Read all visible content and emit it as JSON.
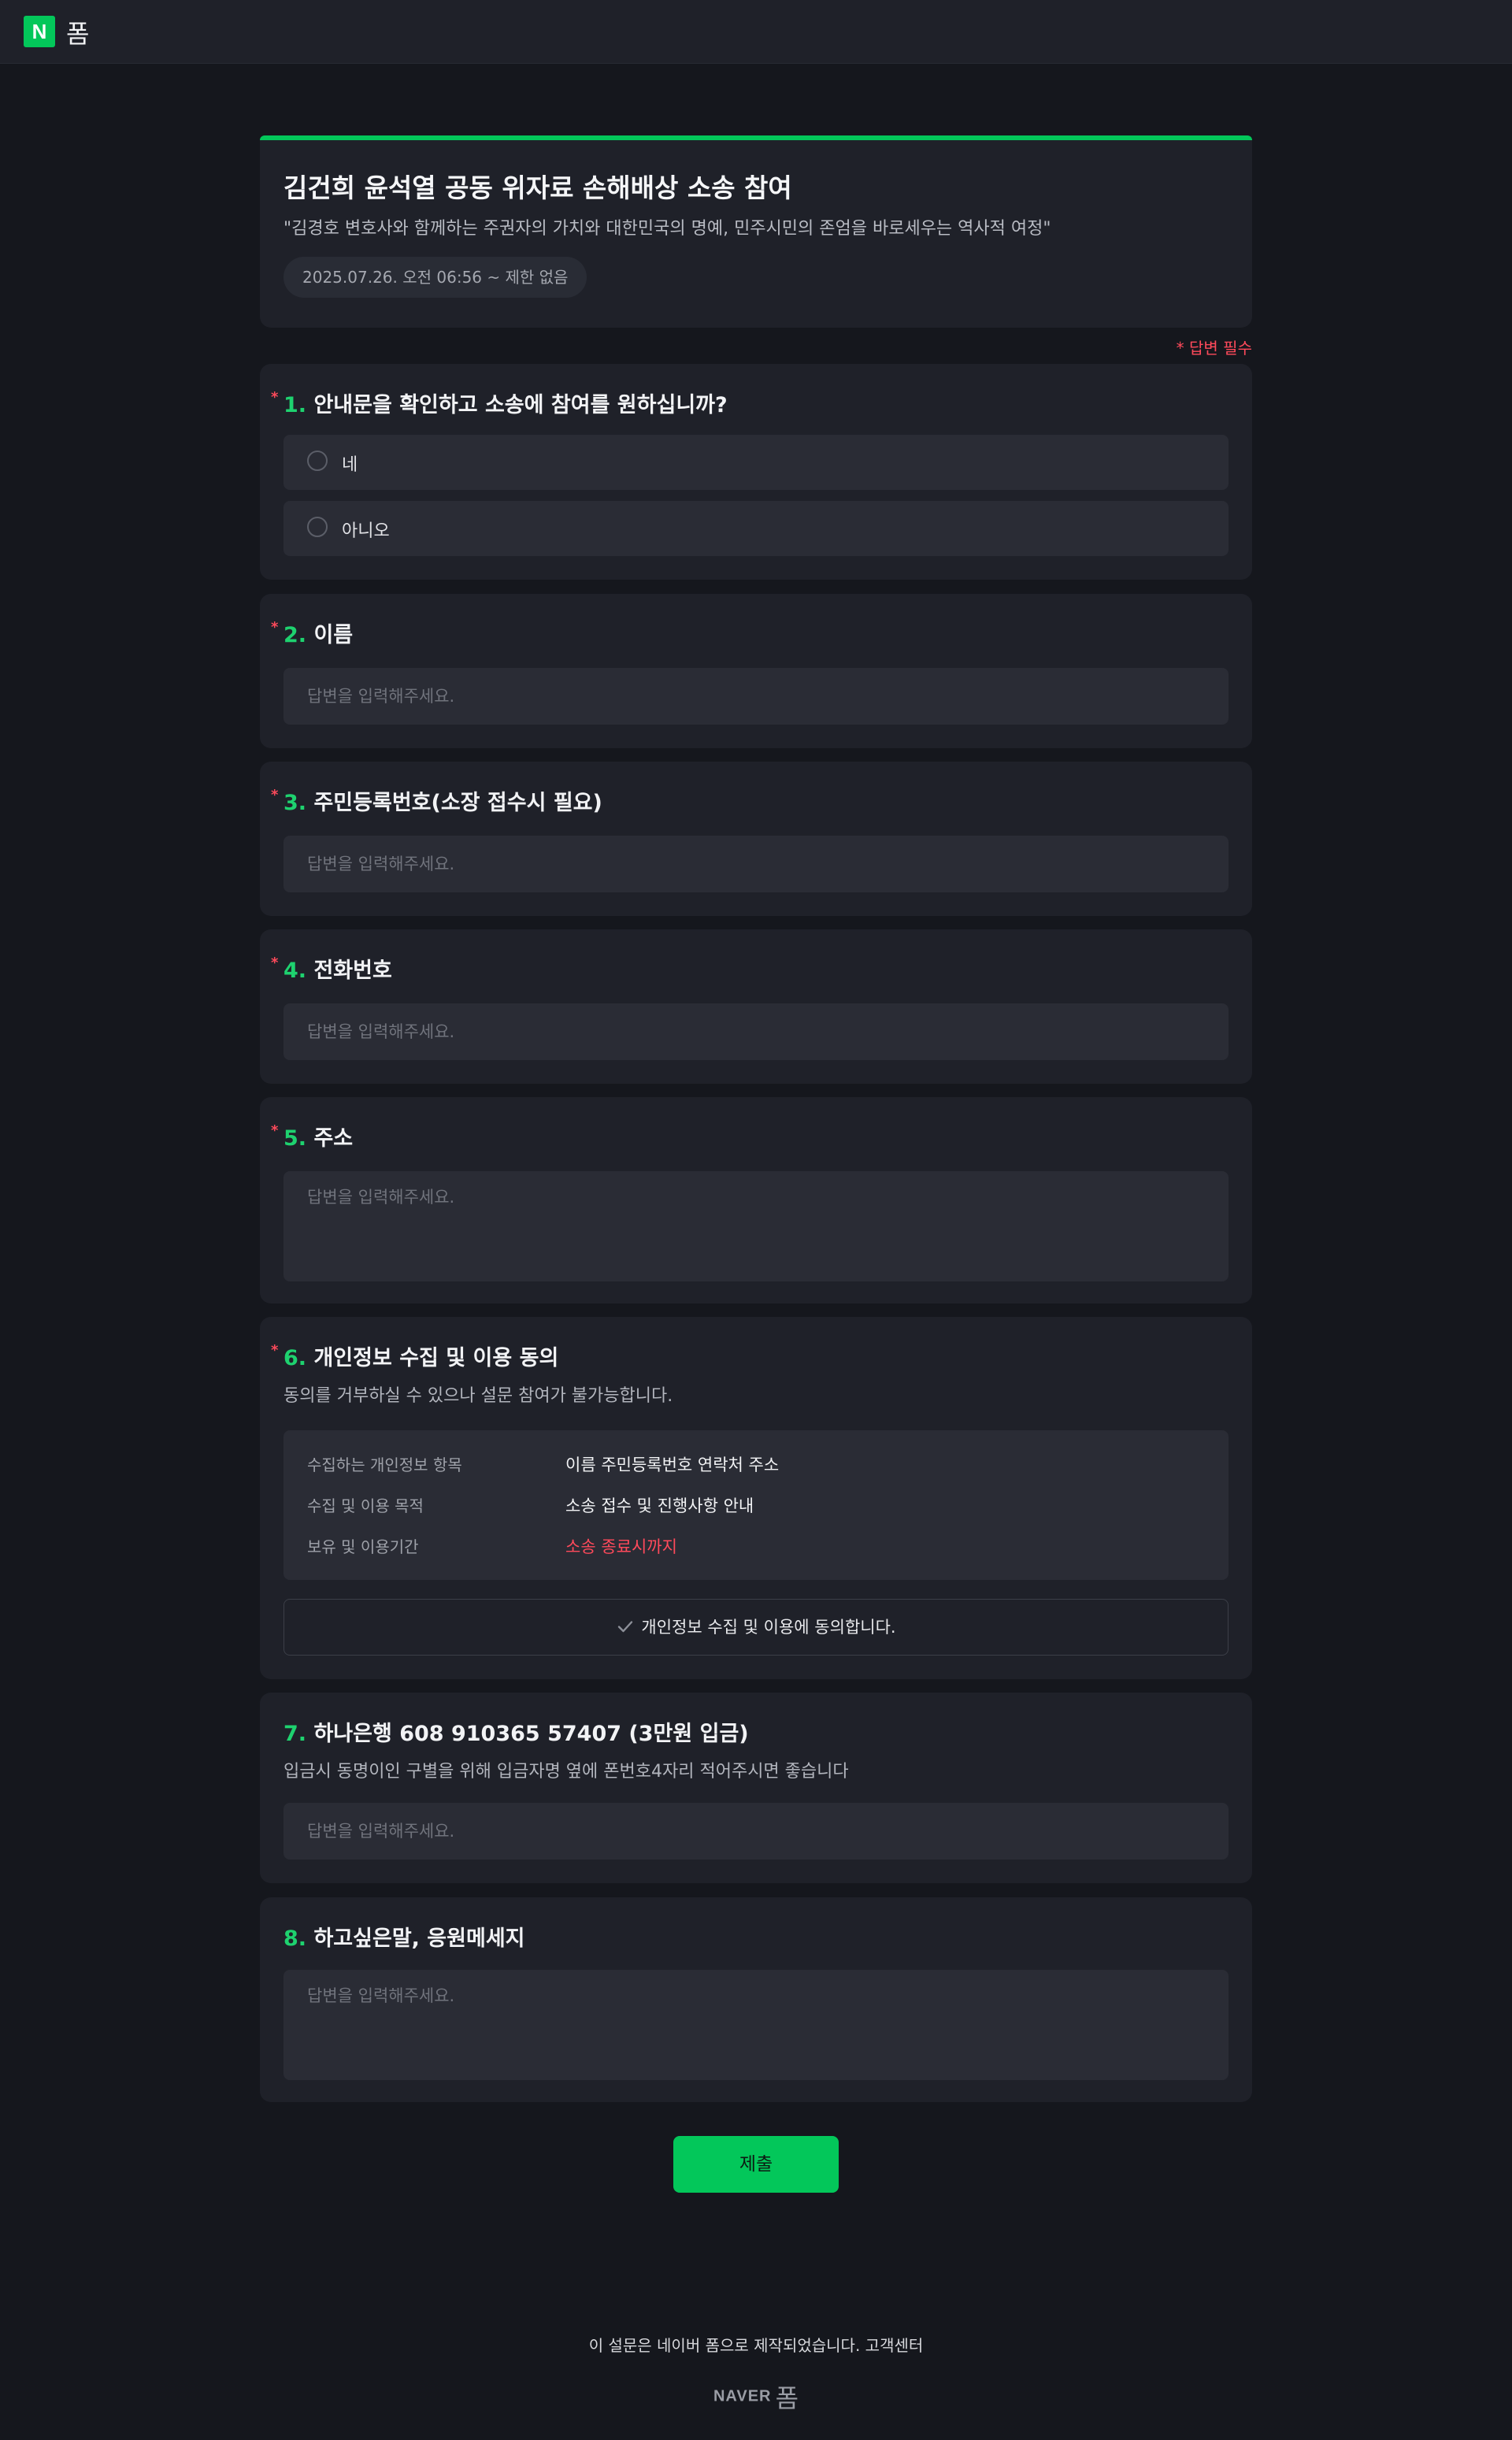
{
  "app": {
    "logo_letter": "N",
    "logo_text": "폼",
    "accent_color": "#03c75a",
    "required_color": "#ff4a5b"
  },
  "form": {
    "title": "김건희 윤석열 공동 위자료 손해배상 소송 참여",
    "description": "\"김경호 변호사와 함께하는 주권자의 가치와 대한민국의 명예, 민주시민의 존엄을 바로세우는 역사적 여정\"",
    "period": "2025.07.26. 오전 06:56 ~ 제한 없음",
    "required_note": "* 답변 필수"
  },
  "questions": [
    {
      "star": "*",
      "num": "1.",
      "title": "안내문을 확인하고 소송에 참여를 원하십니까?",
      "options": [
        "네",
        "아니오"
      ]
    },
    {
      "star": "*",
      "num": "2.",
      "title": "이름",
      "placeholder": "답변을 입력해주세요."
    },
    {
      "star": "*",
      "num": "3.",
      "title": "주민등록번호(소장 접수시 필요)",
      "placeholder": "답변을 입력해주세요."
    },
    {
      "star": "*",
      "num": "4.",
      "title": "전화번호",
      "placeholder": "답변을 입력해주세요."
    },
    {
      "star": "*",
      "num": "5.",
      "title": "주소",
      "placeholder": "답변을 입력해주세요."
    },
    {
      "star": "*",
      "num": "6.",
      "title": "개인정보 수집 및 이용 동의",
      "subtitle": "동의를 거부하실 수 있으나 설문 참여가 불가능합니다.",
      "privacy": [
        {
          "key": "수집하는 개인정보 항목",
          "value": "이름 주민등록번호 연락처 주소"
        },
        {
          "key": "수집 및 이용 목적",
          "value": "소송 접수 및 진행사항 안내"
        },
        {
          "key": "보유 및 이용기간",
          "value": "소송 종료시까지"
        }
      ],
      "agree_label": "개인정보 수집 및 이용에 동의합니다."
    },
    {
      "num": "7.",
      "title": "하나은행 608 910365 57407 (3만원 입금)",
      "subtitle": "입금시 동명이인 구별을 위해 입금자명 옆에 폰번호4자리 적어주시면 좋습니다",
      "placeholder": "답변을 입력해주세요."
    },
    {
      "num": "8.",
      "title": "하고싶은말, 응원메세지",
      "placeholder": "답변을 입력해주세요."
    }
  ],
  "submit_label": "제출",
  "footer": {
    "text": "이 설문은 네이버 폼으로 제작되었습니다. 고객센터",
    "logo_naver": "NAVER",
    "logo_pom": "폼"
  }
}
